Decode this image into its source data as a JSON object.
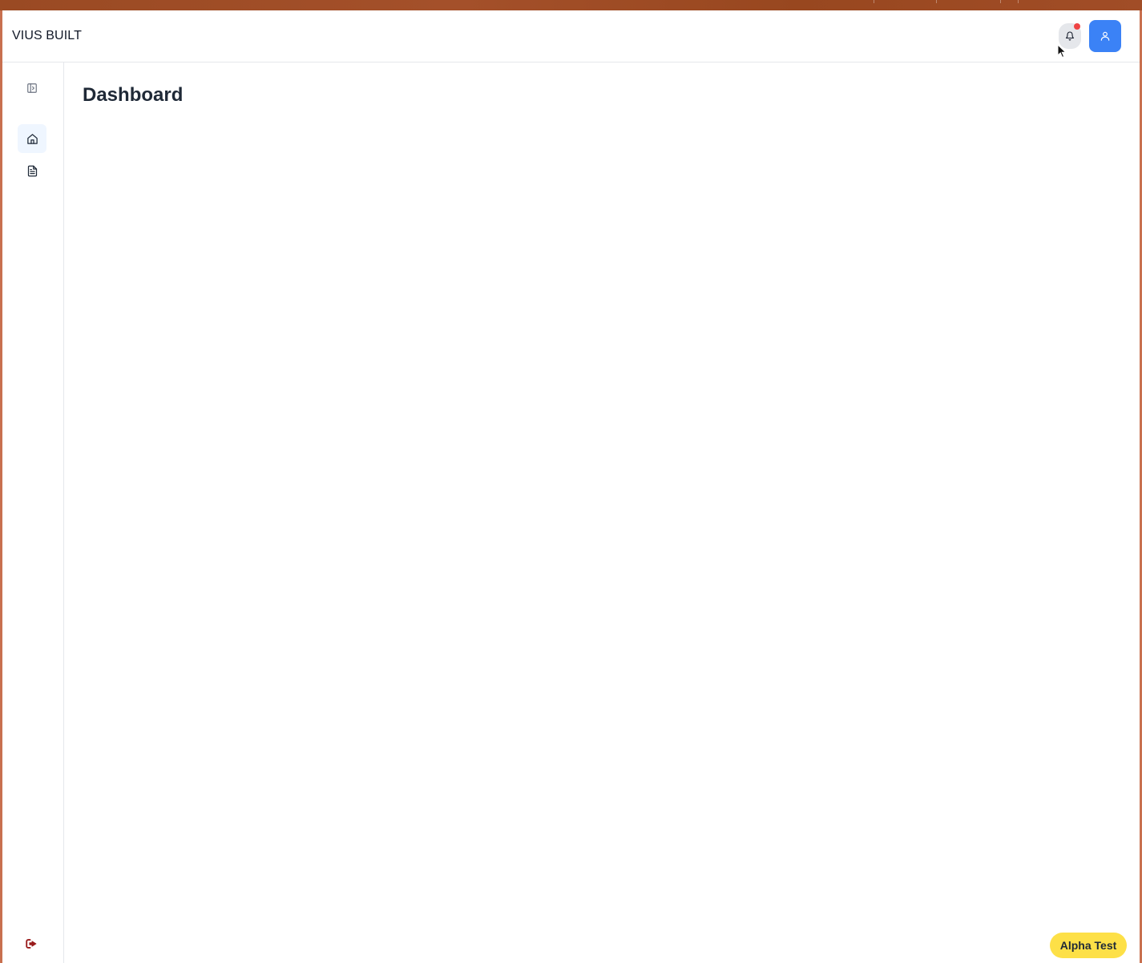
{
  "header": {
    "brand": "VIUS BUILT",
    "notifications_icon": "bell-icon",
    "notification_badge_color": "#ef4444",
    "user_icon": "user-icon",
    "user_button_color": "#3b82f6"
  },
  "sidebar": {
    "toggle_icon": "sidebar-toggle-icon",
    "items": [
      {
        "icon": "home-icon",
        "active": true
      },
      {
        "icon": "document-icon",
        "active": false
      }
    ],
    "logout_icon": "logout-icon",
    "logout_color": "#991b1b"
  },
  "main": {
    "title": "Dashboard"
  },
  "badge": {
    "label": "Alpha Test",
    "color": "#fde047"
  }
}
